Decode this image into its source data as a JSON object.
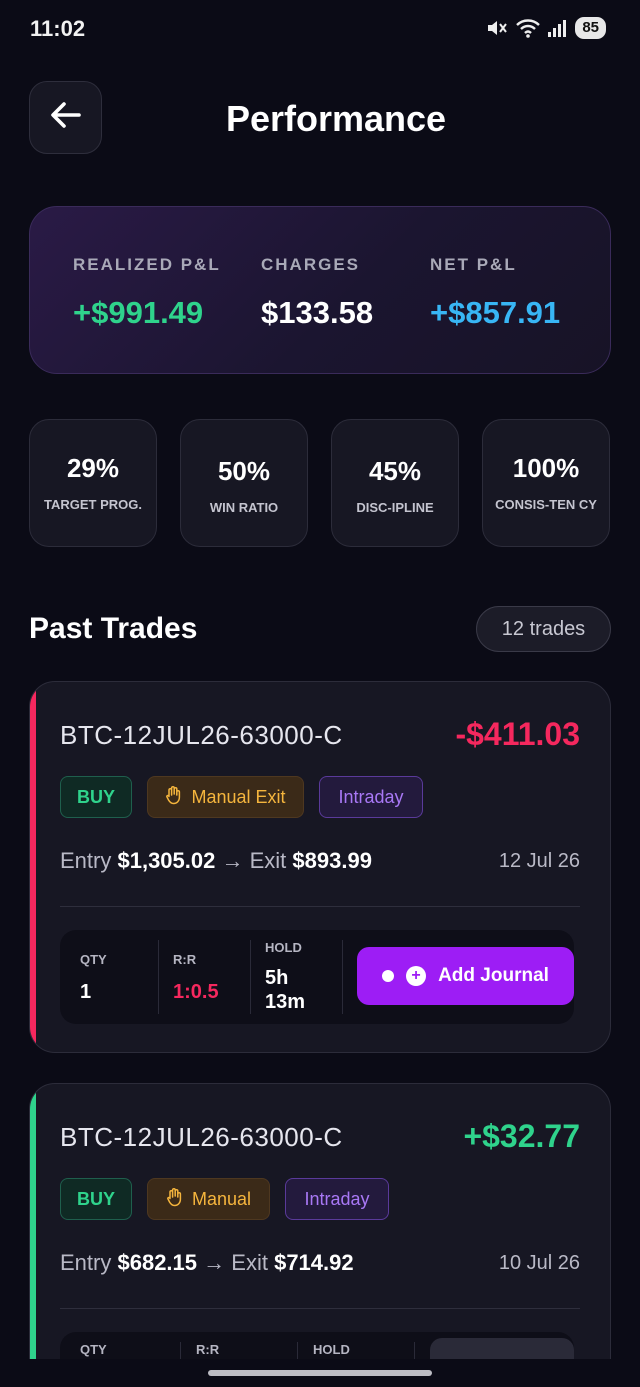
{
  "status_bar": {
    "time": "11:02",
    "battery": "85",
    "icons": [
      "mute-icon",
      "wifi-icon",
      "signal-icon",
      "battery-icon"
    ]
  },
  "header": {
    "title": "Performance",
    "back_icon": "arrow-left-icon"
  },
  "summary": {
    "realized_label": "REALIZED P&L",
    "realized_value": "+$991.49",
    "charges_label": "CHARGES",
    "charges_value": "$133.58",
    "net_label": "NET P&L",
    "net_value": "+$857.91",
    "colors": {
      "positive": "#2fd38c",
      "net": "#38b6f5"
    }
  },
  "stats": [
    {
      "value": "29%",
      "label": "TARGET PROG."
    },
    {
      "value": "50%",
      "label": "WIN RATIO"
    },
    {
      "value": "45%",
      "label": "DISC-IPLINE"
    },
    {
      "value": "100%",
      "label": "CONSIS-TEN CY"
    }
  ],
  "past_trades": {
    "title": "Past Trades",
    "count": "12 trades",
    "trades": [
      {
        "instrument": "BTC-12JUL26-63000-C",
        "pnl": "-$411.03",
        "pnl_color": "#f5285e",
        "tags": {
          "side": "BUY",
          "exit": "Manual Exit",
          "type": "Intraday"
        },
        "entry_label": "Entry",
        "entry_price": "$1,305.02",
        "arrow": "→",
        "exit_label": "Exit",
        "exit_price": "$893.99",
        "date": "12 Jul 26",
        "qty_label": "QTY",
        "qty": "1",
        "rr_label": "R:R",
        "rr": "1:0.5",
        "hold_label": "HOLD",
        "hold_line1": "5h",
        "hold_line2": "13m",
        "journal_label": "Add Journal"
      },
      {
        "instrument": "BTC-12JUL26-63000-C",
        "pnl": "+$32.77",
        "pnl_color": "#2fd38c",
        "tags": {
          "side": "BUY",
          "exit": "Manual",
          "type": "Intraday"
        },
        "entry_label": "Entry",
        "entry_price": "$682.15",
        "arrow": "→",
        "exit_label": "Exit",
        "exit_price": "$714.92",
        "date": "10 Jul 26",
        "qty_label": "QTY",
        "rr_label": "R:R",
        "hold_label": "HOLD"
      }
    ]
  }
}
